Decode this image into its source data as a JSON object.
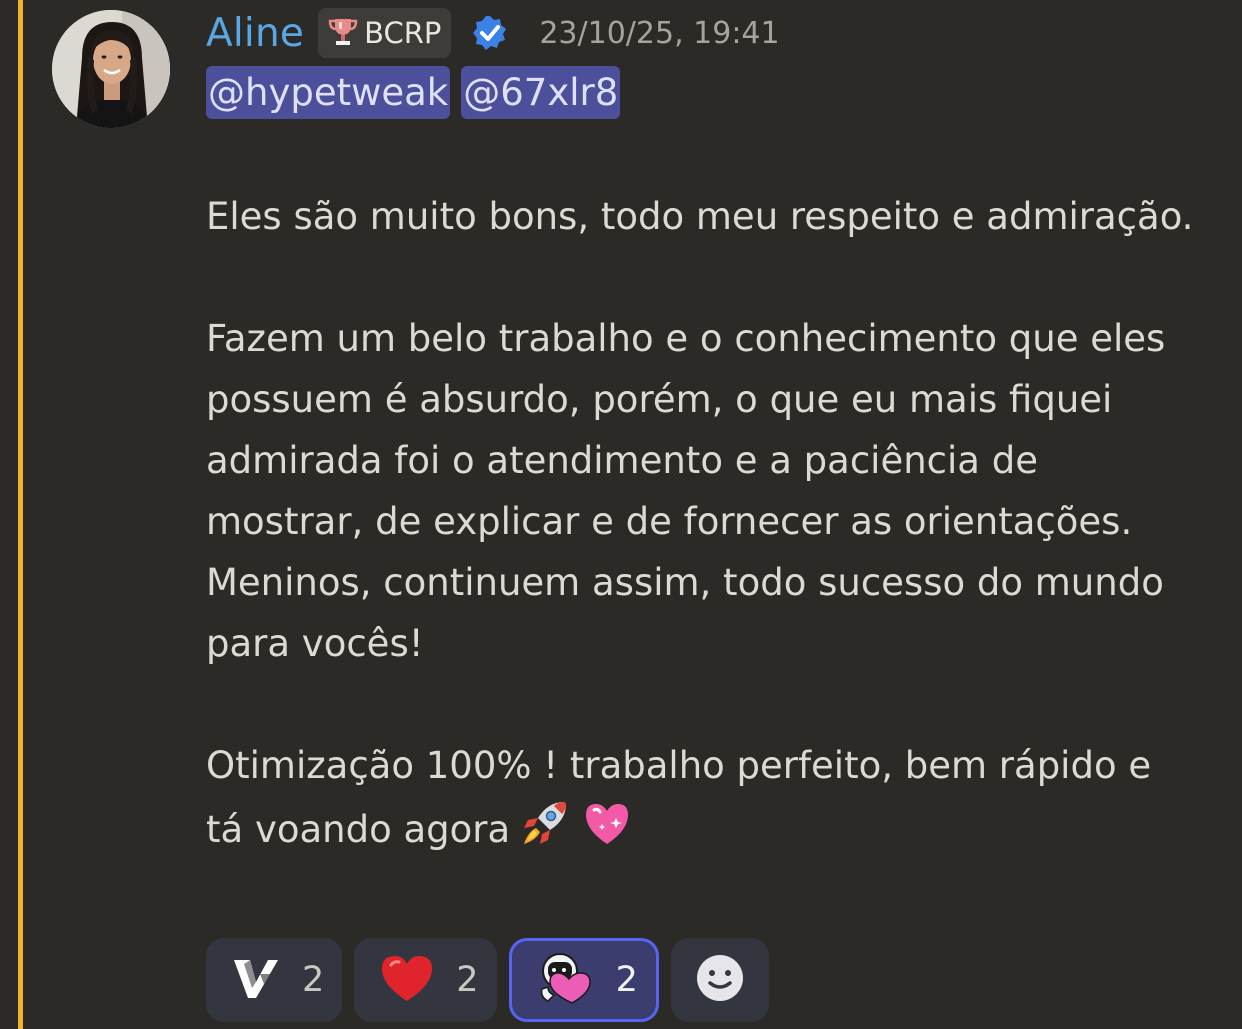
{
  "message": {
    "author": "Aline",
    "tag": {
      "label": "BCRP",
      "icon": "trophy-icon"
    },
    "verified_icon": "verified-badge-icon",
    "timestamp": "23/10/25, 19:41",
    "mentions": [
      "@hypetweak",
      "@67xlr8"
    ],
    "paragraphs": [
      "Eles são muito bons, todo meu respeito e admiração.",
      "Fazem um belo trabalho e o conhecimento que eles possuem é absurdo, porém, o que eu mais fiquei admirada foi o atendimento e a paciência de mostrar, de explicar e de fornecer as orientações. Meninos, continuem assim, todo sucesso do mundo para vocês!",
      "Otimização 100% ! trabalho perfeito, bem rápido e tá voando agora"
    ],
    "inline_emojis": [
      "rocket-emoji",
      "sparkling-heart-emoji"
    ],
    "highlight_color": "#f0b232",
    "author_color": "#5aa7e6",
    "mention_bg": "#4c4f99"
  },
  "reactions": [
    {
      "emoji": "v-logo-emoji",
      "count": "2",
      "active": false
    },
    {
      "emoji": "red-heart-emoji",
      "count": "2",
      "active": false
    },
    {
      "emoji": "astronaut-heart-emoji",
      "count": "2",
      "active": true
    }
  ],
  "add_reaction_icon": "add-reaction-smiley-icon"
}
